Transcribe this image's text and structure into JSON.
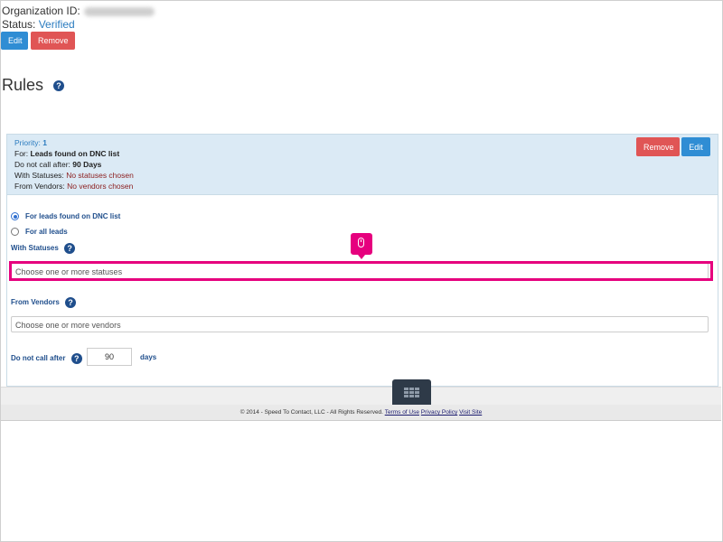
{
  "organization": {
    "id_label": "Organization ID:",
    "status_label": "Status:",
    "status_value": "Verified",
    "edit_label": "Edit",
    "remove_label": "Remove"
  },
  "rules": {
    "title": "Rules"
  },
  "rule_card": {
    "priority_label": "Priority:",
    "priority_value": "1",
    "for_label": "For:",
    "for_value": "Leads found on DNC list",
    "dnc_after_label": "Do not call after:",
    "dnc_after_value": "90 Days",
    "with_statuses_label": "With Statuses:",
    "with_statuses_value": "No statuses chosen",
    "from_vendors_label": "From Vendors:",
    "from_vendors_value": "No vendors chosen",
    "remove_label": "Remove",
    "edit_label": "Edit"
  },
  "form": {
    "radio_dnc": "For leads found on DNC list",
    "radio_all": "For all leads",
    "with_statuses_label": "With Statuses",
    "statuses_placeholder": "Choose one or more statuses",
    "from_vendors_label": "From Vendors",
    "vendors_placeholder": "Choose one or more vendors",
    "dnc_after_label": "Do not call after",
    "days_value": "90",
    "days_label": "days"
  },
  "footer": {
    "copyright": "© 2014 - Speed To Contact, LLC - All Rights Reserved.",
    "terms": "Terms of Use",
    "privacy": "Privacy Policy",
    "visit": "Visit Site"
  },
  "colors": {
    "accent_blue": "#2f8dd4",
    "remove_red": "#e05555",
    "highlight_pink": "#e6007e",
    "header_bg": "#dbeaf5"
  },
  "icons": [
    "help-icon",
    "mouse-icon",
    "grid-icon"
  ]
}
